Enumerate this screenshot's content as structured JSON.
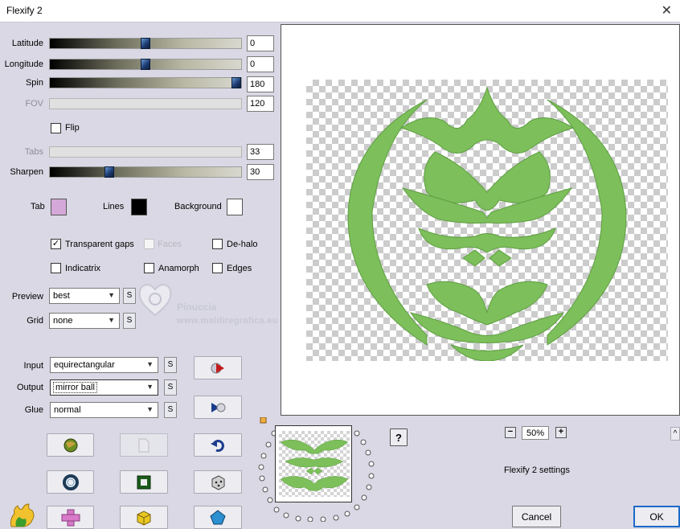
{
  "window": {
    "title": "Flexify 2",
    "close_glyph": "✕"
  },
  "params": {
    "latitude": {
      "label": "Latitude",
      "value": "0",
      "level": 0.5
    },
    "longitude": {
      "label": "Longitude",
      "value": "0",
      "level": 0.5
    },
    "spin": {
      "label": "Spin",
      "value": "180",
      "level": 1.0
    },
    "fov": {
      "label": "FOV",
      "value": "120"
    },
    "flip": {
      "label": "Flip",
      "checked": false
    },
    "tabs": {
      "label": "Tabs",
      "value": "33"
    },
    "sharpen": {
      "label": "Sharpen",
      "value": "30",
      "level": 0.3
    }
  },
  "colors": {
    "tab": {
      "label": "Tab",
      "color": "#d4a8d8"
    },
    "lines": {
      "label": "Lines",
      "color": "#000000"
    },
    "background": {
      "label": "Background",
      "color": "#ffffff"
    }
  },
  "options": {
    "transparent_gaps": {
      "label": "Transparent gaps",
      "checked": true
    },
    "faces": {
      "label": "Faces",
      "checked": false,
      "enabled": false
    },
    "de_halo": {
      "label": "De-halo",
      "checked": false
    },
    "indicatrix": {
      "label": "Indicatrix",
      "checked": false
    },
    "anamorph": {
      "label": "Anamorph",
      "checked": false
    },
    "edges": {
      "label": "Edges",
      "checked": false
    }
  },
  "selects": {
    "preview": {
      "label": "Preview",
      "value": "best"
    },
    "grid": {
      "label": "Grid",
      "value": "none"
    },
    "input": {
      "label": "Input",
      "value": "equirectangular"
    },
    "output": {
      "label": "Output",
      "value": "mirror ball"
    },
    "glue": {
      "label": "Glue",
      "value": "normal"
    },
    "s_glyph": "S",
    "arrow_glyph": "▼"
  },
  "watermark": {
    "name": "Pinuccia",
    "url": "www.maldiregrafica.eu"
  },
  "zoom": {
    "minus": "−",
    "value": "50%",
    "plus": "+"
  },
  "status": {
    "text": "Flexify 2 settings"
  },
  "help": {
    "glyph": "?"
  },
  "buttons": {
    "cancel": "Cancel",
    "ok": "OK",
    "collapse": "^"
  },
  "image": {
    "shape_color": "#7dbf5a",
    "shape_dark": "#5e9e43"
  }
}
